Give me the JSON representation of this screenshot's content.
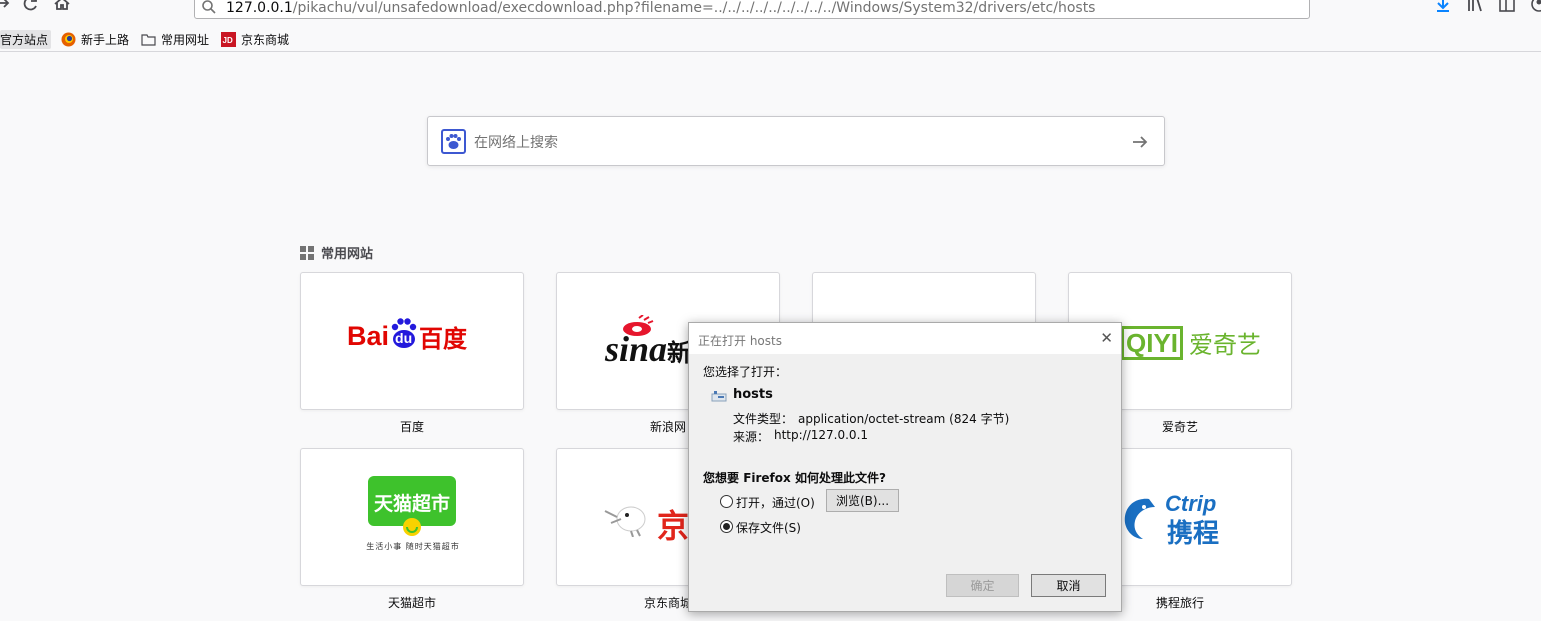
{
  "toolbar": {
    "url_host": "127.0.0.1",
    "url_path": "/pikachu/vul/unsafedownload/execdownload.php?filename=../../../../../../../../../Windows/System32/drivers/etc/hosts"
  },
  "bookmarks": [
    {
      "label": "官方站点",
      "icon": "firefox-icon"
    },
    {
      "label": "新手上路",
      "icon": "firefox-icon"
    },
    {
      "label": "常用网址",
      "icon": "folder-icon"
    },
    {
      "label": "京东商城",
      "icon": "jd-icon"
    }
  ],
  "search": {
    "placeholder": "在网络上搜索"
  },
  "top_sites": {
    "header": "常用网站",
    "tiles": [
      {
        "label": "百度",
        "logo": "Bai",
        "logo2": "du",
        "logo3": "百度"
      },
      {
        "label": "新浪网",
        "logo": "sina",
        "logo2": "新"
      },
      {
        "label": "",
        "logo": ""
      },
      {
        "label": "爱奇艺",
        "logo": "QIYI",
        "logo2": "爱奇艺"
      },
      {
        "label": "天猫超市",
        "logo": "天猫超市",
        "logo2": "生活小事 随时天猫超市"
      },
      {
        "label": "京东商城",
        "logo": "京"
      },
      {
        "label": "",
        "logo": ""
      },
      {
        "label": "携程旅行",
        "logo": "Ctrip",
        "logo2": "携程"
      }
    ]
  },
  "dialog": {
    "title": "正在打开 hosts",
    "intro": "您选择了打开：",
    "filename": "hosts",
    "type_label": "文件类型：",
    "type_value": "application/octet-stream (824 字节)",
    "source_label": "来源：",
    "source_value": "http://127.0.0.1",
    "question_pre": "您想要 ",
    "question_app": "Firefox",
    "question_post": " 如何处理此文件?",
    "open_with_label": "打开，通过(O)",
    "browse_label": "浏览(B)...",
    "save_label": "保存文件(S)",
    "ok_label": "确定",
    "cancel_label": "取消",
    "selected_option": "save"
  },
  "colors": {
    "baidu_red": "#e10602",
    "baidu_blue": "#2319dc",
    "iqiyi_green": "#6ab42e",
    "tmall_green": "#3ec22c",
    "ctrip_blue": "#1a6fc2",
    "jd_red": "#e1251b"
  }
}
